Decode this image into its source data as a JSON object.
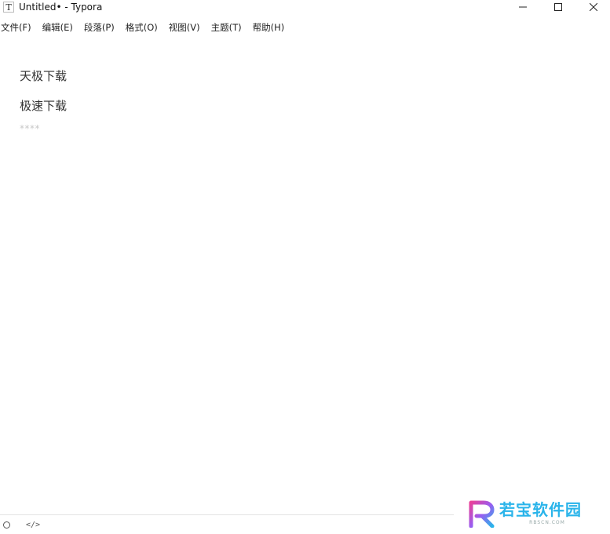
{
  "window": {
    "title": "Untitled• - Typora",
    "app_icon_glyph": "T",
    "controls": {
      "minimize_icon": "minimize-icon",
      "maximize_icon": "maximize-icon",
      "close_icon": "close-icon"
    }
  },
  "menubar": {
    "items": [
      {
        "label": "文件(F)"
      },
      {
        "label": "编辑(E)"
      },
      {
        "label": "段落(P)"
      },
      {
        "label": "格式(O)"
      },
      {
        "label": "视图(V)"
      },
      {
        "label": "主题(T)"
      },
      {
        "label": "帮助(H)"
      }
    ]
  },
  "editor": {
    "paragraphs": [
      "天极下载",
      "极速下载"
    ],
    "hr_source": "****"
  },
  "statusbar": {
    "outline_icon": "circle-icon",
    "source_mode_glyph": "</>"
  },
  "watermark": {
    "text": "若宝软件园",
    "subtext": "RBSCN.COM",
    "colors": {
      "primary": "#2ab4ea",
      "accent": "#e8409a"
    }
  }
}
